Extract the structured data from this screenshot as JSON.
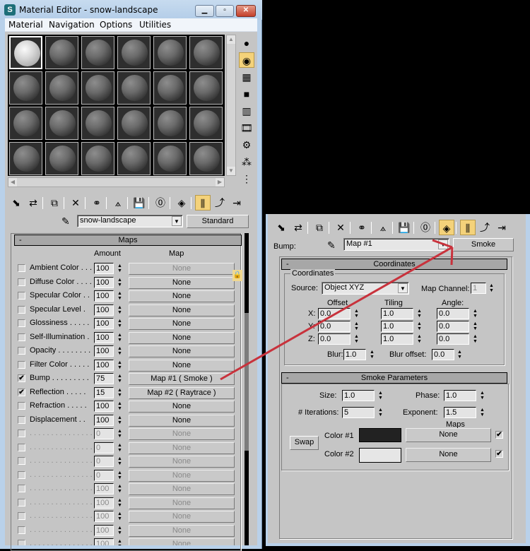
{
  "window": {
    "title": "Material Editor - snow-landscape",
    "app_icon": "3ds-max-icon",
    "controls": {
      "minimize": "▁",
      "maximize": "▫",
      "close": "✕"
    }
  },
  "menu": [
    "Material",
    "Navigation",
    "Options",
    "Utilities"
  ],
  "sample_slots": {
    "rows": 4,
    "cols": 6,
    "selected_index": 0,
    "selected_material": "snow"
  },
  "side_tools": [
    {
      "icon": "sample-type-sphere-icon",
      "glyph": "●"
    },
    {
      "icon": "backlight-icon",
      "glyph": "◉",
      "active": true
    },
    {
      "icon": "background-checker-icon",
      "glyph": "▦"
    },
    {
      "icon": "sample-uv-tiling-icon",
      "glyph": "■"
    },
    {
      "icon": "video-color-check-icon",
      "glyph": "▥"
    },
    {
      "icon": "make-preview-icon",
      "glyph": "🎞"
    },
    {
      "icon": "options-icon",
      "glyph": "⚙"
    },
    {
      "icon": "select-by-material-icon",
      "glyph": "⁂"
    },
    {
      "icon": "material-navigator-icon",
      "glyph": "⋮"
    }
  ],
  "toolbar": [
    {
      "icon": "get-material-icon",
      "glyph": "⬊"
    },
    {
      "icon": "put-to-scene-icon",
      "glyph": "⇄"
    },
    {
      "icon": "assign-to-selection-icon",
      "glyph": "⧉"
    },
    {
      "icon": "reset-map-icon",
      "glyph": "✕"
    },
    {
      "icon": "make-copy-icon",
      "glyph": "⚭"
    },
    {
      "icon": "make-unique-icon",
      "glyph": "⟑"
    },
    {
      "icon": "put-to-library-icon",
      "glyph": "💾"
    },
    {
      "icon": "material-id-channel-icon",
      "glyph": "⓪"
    },
    {
      "icon": "show-map-in-viewport-icon",
      "glyph": "◈"
    },
    {
      "icon": "show-end-result-icon",
      "glyph": "⫼",
      "active": true
    },
    {
      "icon": "go-to-parent-icon",
      "glyph": "⤴"
    },
    {
      "icon": "go-forward-to-sibling-icon",
      "glyph": "⇥"
    }
  ],
  "material_name": "snow-landscape",
  "material_type": "Standard",
  "maps_rollout": {
    "title": "Maps",
    "collapse": "-",
    "col_amount": "Amount",
    "col_map": "Map",
    "rows": [
      {
        "label": "Ambient Color . . .",
        "checked": false,
        "amount": "100",
        "map": "None",
        "dim_map": true
      },
      {
        "label": "Diffuse Color . . . .",
        "checked": false,
        "amount": "100",
        "map": "None"
      },
      {
        "label": "Specular Color . .",
        "checked": false,
        "amount": "100",
        "map": "None"
      },
      {
        "label": "Specular Level  .",
        "checked": false,
        "amount": "100",
        "map": "None"
      },
      {
        "label": "Glossiness  . . . . .",
        "checked": false,
        "amount": "100",
        "map": "None"
      },
      {
        "label": "Self-Illumination .",
        "checked": false,
        "amount": "100",
        "map": "None"
      },
      {
        "label": "Opacity . . . . . . . .",
        "checked": false,
        "amount": "100",
        "map": "None"
      },
      {
        "label": "Filter Color  . . . . .",
        "checked": false,
        "amount": "100",
        "map": "None"
      },
      {
        "label": "Bump  . . . . . . . . .",
        "checked": true,
        "amount": "75",
        "map": "Map #1  ( Smoke )"
      },
      {
        "label": "Reflection  . . . . .",
        "checked": true,
        "amount": "15",
        "map": "Map #2  ( Raytrace )"
      },
      {
        "label": "Refraction  . . . . .",
        "checked": false,
        "amount": "100",
        "map": "None"
      },
      {
        "label": "Displacement  . .",
        "checked": false,
        "amount": "100",
        "map": "None"
      },
      {
        "label": ". . . . . . . . . . . . . . .",
        "checked": false,
        "amount": "0",
        "map": "None",
        "dim": true
      },
      {
        "label": ". . . . . . . . . . . . . . .",
        "checked": false,
        "amount": "0",
        "map": "None",
        "dim": true
      },
      {
        "label": ". . . . . . . . . . . . . . .",
        "checked": false,
        "amount": "0",
        "map": "None",
        "dim": true
      },
      {
        "label": ". . . . . . . . . . . . . . .",
        "checked": false,
        "amount": "0",
        "map": "None",
        "dim": true
      },
      {
        "label": ". . . . . . . . . . . . . . .",
        "checked": false,
        "amount": "100",
        "map": "None",
        "dim": true
      },
      {
        "label": ". . . . . . . . . . . . . . .",
        "checked": false,
        "amount": "100",
        "map": "None",
        "dim": true
      },
      {
        "label": ". . . . . . . . . . . . . . .",
        "checked": false,
        "amount": "100",
        "map": "None",
        "dim": true
      },
      {
        "label": ". . . . . . . . . . . . . . .",
        "checked": false,
        "amount": "100",
        "map": "None",
        "dim": true
      },
      {
        "label": ". . . . . . . . . . . . . . .",
        "checked": false,
        "amount": "100",
        "map": "None",
        "dim": true
      }
    ],
    "lock_icon": "lock-icon"
  },
  "map_panel": {
    "slot_label": "Bump:",
    "map_name": "Map #1",
    "map_type": "Smoke",
    "coordinates": {
      "title": "Coordinates",
      "group_label": "Coordinates",
      "source_label": "Source:",
      "source_value": "Object XYZ",
      "map_channel_label": "Map Channel:",
      "map_channel_value": "1",
      "offset_label": "Offset",
      "tiling_label": "Tiling",
      "angle_label": "Angle:",
      "axes": [
        {
          "axis": "X:",
          "offset": "0.0",
          "tiling": "1.0",
          "angle": "0.0"
        },
        {
          "axis": "Y:",
          "offset": "0.0",
          "tiling": "1.0",
          "angle": "0.0"
        },
        {
          "axis": "Z:",
          "offset": "0.0",
          "tiling": "1.0",
          "angle": "0.0"
        }
      ],
      "blur_label": "Blur:",
      "blur_value": "1.0",
      "blur_offset_label": "Blur offset:",
      "blur_offset_value": "0.0"
    },
    "smoke": {
      "title": "Smoke Parameters",
      "size_label": "Size:",
      "size_value": "1.0",
      "phase_label": "Phase:",
      "phase_value": "1.0",
      "iterations_label": "# Iterations:",
      "iterations_value": "5",
      "exponent_label": "Exponent:",
      "exponent_value": "1.5",
      "maps_label": "Maps",
      "swap_label": "Swap",
      "color1_label": "Color #1",
      "color1": "#222222",
      "color1_map": "None",
      "color1_map_enabled": true,
      "color2_label": "Color #2",
      "color2": "#e6e6e6",
      "color2_map": "None",
      "color2_map_enabled": true
    }
  },
  "annotation": {
    "type": "arrow",
    "color": "#c8323c"
  }
}
